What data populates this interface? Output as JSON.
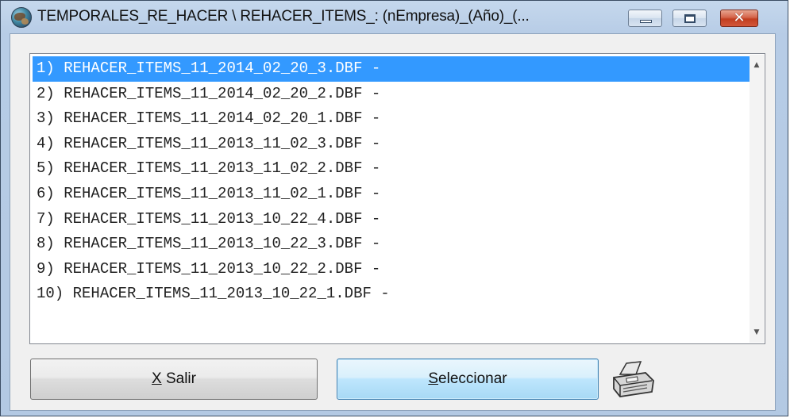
{
  "window": {
    "title": "TEMPORALES_RE_HACER \\ REHACER_ITEMS_: (nEmpresa)_(Año)_(...",
    "icon": "globe-app-icon",
    "controls": [
      "minimize-icon",
      "maximize-icon",
      "close-icon"
    ]
  },
  "list": {
    "selected_index": 0,
    "items": [
      "1) REHACER_ITEMS_11_2014_02_20_3.DBF -",
      "2) REHACER_ITEMS_11_2014_02_20_2.DBF -",
      "3) REHACER_ITEMS_11_2014_02_20_1.DBF -",
      "4) REHACER_ITEMS_11_2013_11_02_3.DBF -",
      "5) REHACER_ITEMS_11_2013_11_02_2.DBF -",
      "6) REHACER_ITEMS_11_2013_11_02_1.DBF -",
      "7) REHACER_ITEMS_11_2013_10_22_4.DBF -",
      "8) REHACER_ITEMS_11_2013_10_22_3.DBF -",
      "9) REHACER_ITEMS_11_2013_10_22_2.DBF -",
      "10) REHACER_ITEMS_11_2013_10_22_1.DBF -"
    ]
  },
  "buttons": {
    "salir_mnemonic": "X",
    "salir_rest": " Salir",
    "seleccionar_mnemonic": "S",
    "seleccionar_rest": "eleccionar"
  },
  "colors": {
    "selection": "#3399ff",
    "close_button": "#c23e20"
  },
  "icons": {
    "printer": "printer-icon",
    "scroll_up": "scroll-up-arrow-icon",
    "scroll_down": "scroll-down-arrow-icon"
  }
}
